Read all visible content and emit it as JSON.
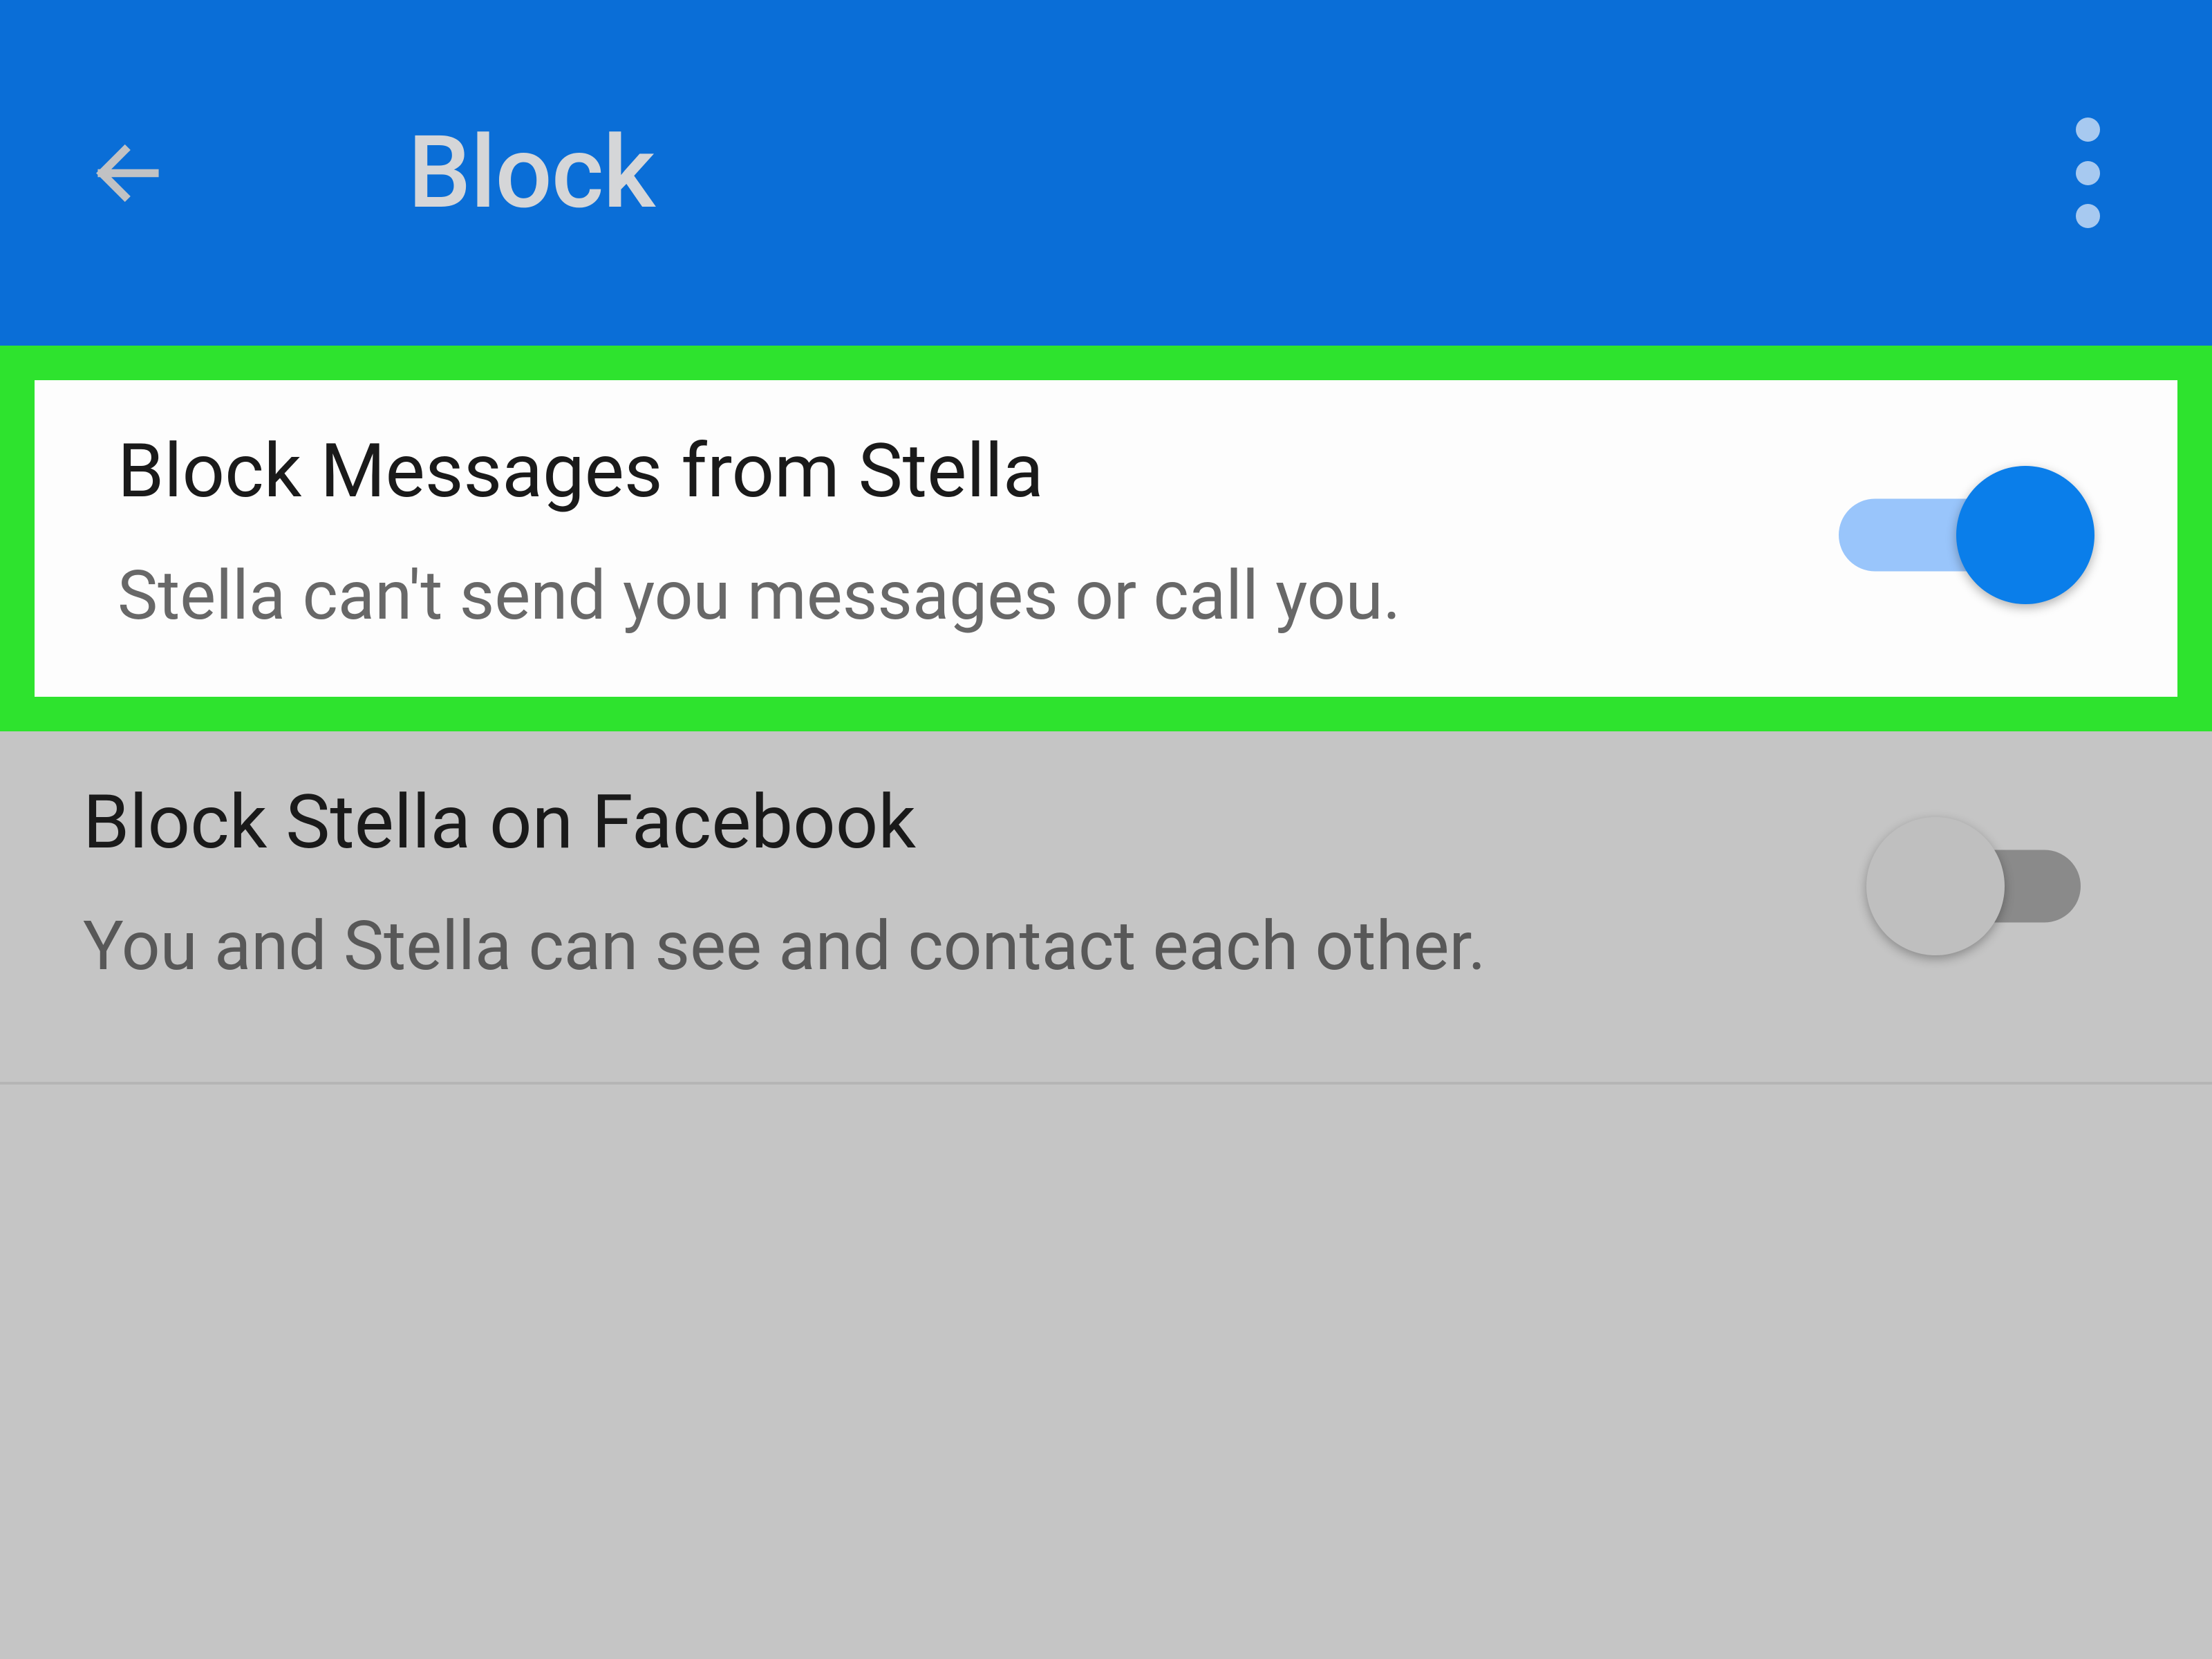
{
  "header": {
    "title": "Block"
  },
  "settings": [
    {
      "title": "Block Messages from Stella",
      "description": "Stella can't send you messages or call you.",
      "toggle_on": true,
      "highlighted": true
    },
    {
      "title": "Block Stella on Facebook",
      "description": "You and Stella can see and contact each other.",
      "toggle_on": false,
      "highlighted": false
    }
  ],
  "colors": {
    "primary": "#0a6ed7",
    "highlight": "#2ee32e",
    "toggle_on_track": "#99c5fb",
    "toggle_on_thumb": "#0a7eea",
    "toggle_off_track": "#8a8a8a",
    "toggle_off_thumb": "#bfbfbf"
  }
}
